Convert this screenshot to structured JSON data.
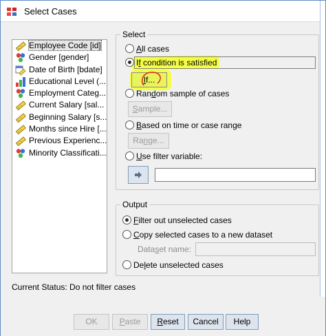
{
  "window": {
    "title": "Select Cases"
  },
  "variables": [
    {
      "label": "Employee Code [id]",
      "icon": "ruler-icon",
      "selected": true
    },
    {
      "label": "Gender [gender]",
      "icon": "nominal-icon"
    },
    {
      "label": "Date of Birth [bdate]",
      "icon": "calendar-ruler-icon"
    },
    {
      "label": "Educational Level (...",
      "icon": "ordinal-icon"
    },
    {
      "label": "Employment Categ...",
      "icon": "nominal-icon"
    },
    {
      "label": "Current Salary [sal...",
      "icon": "ruler-icon"
    },
    {
      "label": "Beginning Salary [s...",
      "icon": "ruler-icon"
    },
    {
      "label": "Months since Hire [...",
      "icon": "ruler-icon"
    },
    {
      "label": "Previous Experienc...",
      "icon": "ruler-icon"
    },
    {
      "label": "Minority Classificati...",
      "icon": "nominal-icon"
    }
  ],
  "select": {
    "label": "Select",
    "all_cases": {
      "key": "A",
      "rest": "ll cases"
    },
    "if_condition": {
      "key": "f",
      "before": "I",
      "rest": " condition is satisfied"
    },
    "if_button": {
      "key": "I",
      "rest": "f..."
    },
    "random": {
      "key": "d",
      "before": "Ran",
      "rest": "om sample of cases"
    },
    "sample_button": {
      "key": "S",
      "rest": "ample..."
    },
    "time_range": {
      "key": "B",
      "rest": "ased on time or case range"
    },
    "range_button": {
      "key": "n",
      "before": "Ra",
      "rest": "ge..."
    },
    "filter_var": {
      "key": "U",
      "rest": "se filter variable:"
    }
  },
  "output": {
    "label": "Output",
    "filter_out": {
      "key": "F",
      "rest": "ilter out unselected cases"
    },
    "copy": {
      "key": "C",
      "rest": "opy selected cases to a new dataset"
    },
    "dataset_name": {
      "before": "Data",
      "key": "s",
      "rest": "et name:"
    },
    "delete": {
      "before": "De",
      "key": "l",
      "rest": "ete unselected cases"
    }
  },
  "status": "Current Status: Do not filter cases",
  "buttons": {
    "ok": "OK",
    "paste": {
      "key": "P",
      "rest": "aste"
    },
    "reset": {
      "key": "R",
      "rest": "eset"
    },
    "cancel": "Cancel",
    "help": "Help"
  }
}
